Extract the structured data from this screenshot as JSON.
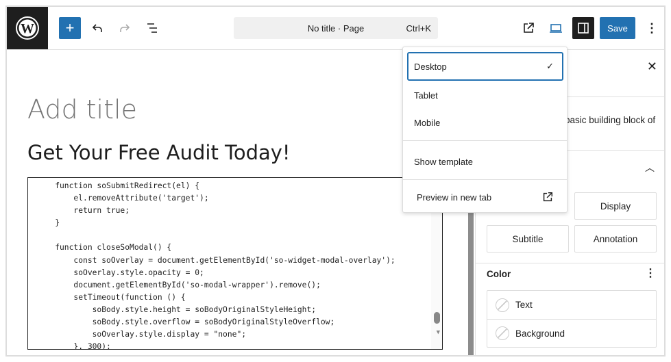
{
  "header": {
    "command_title": "No title · Page",
    "command_shortcut": "Ctrl+K",
    "save_label": "Save",
    "accent": "#2271b1"
  },
  "editor": {
    "title_placeholder": "Add title",
    "heading": "Get Your Free Audit Today!",
    "code_lines": [
      "function soSubmitRedirect(el) {",
      "    el.removeAttribute('target');",
      "    return true;",
      "}",
      "",
      "function closeSoModal() {",
      "    const soOverlay = document.getElementById('so-widget-modal-overlay');",
      "    soOverlay.style.opacity = 0;",
      "    document.getElementById('so-modal-wrapper').remove();",
      "    setTimeout(function () {",
      "        soBody.style.height = soBodyOriginalStyleHeight;",
      "        soBody.style.overflow = soBodyOriginalStyleOverflow;",
      "        soOverlay.style.display = \"none\";",
      "    }, 300);"
    ]
  },
  "preview_menu": {
    "items": [
      {
        "label": "Desktop",
        "selected": true
      },
      {
        "label": "Tablet"
      },
      {
        "label": "Mobile"
      }
    ],
    "show_template": "Show template",
    "preview_new_tab": "Preview in new tab"
  },
  "sidebar": {
    "description": "basic building block of",
    "styles": [
      "Display",
      "Subtitle",
      "Annotation"
    ],
    "color_heading": "Color",
    "color_items": [
      "Text",
      "Background"
    ]
  }
}
